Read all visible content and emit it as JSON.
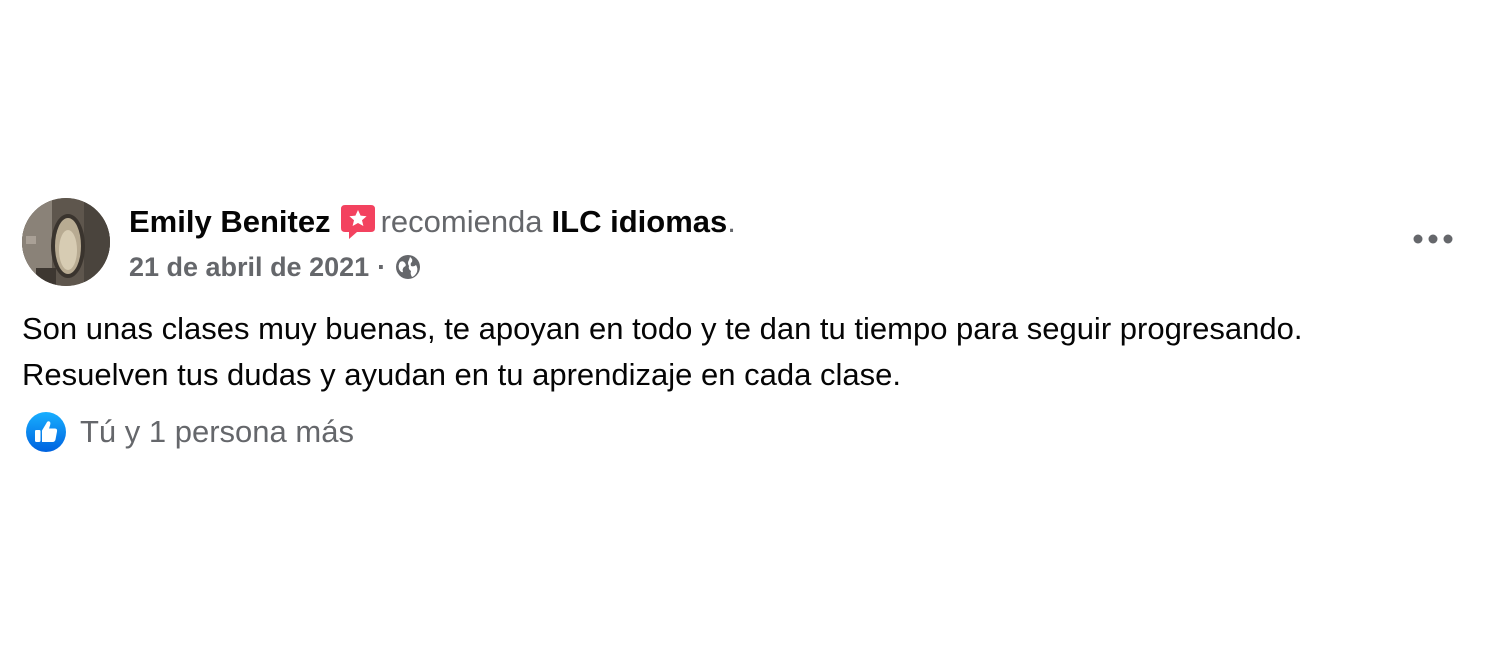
{
  "post": {
    "author_name": "Emily Benitez",
    "verb": "recomienda",
    "page_name": "ILC idiomas",
    "period": ".",
    "date": "21 de abril de 2021",
    "separator": "·",
    "privacy_icon": "globe-icon",
    "recommend_icon": "recommendation-star-icon",
    "more_icon": "more-options-icon",
    "body_lines": [
      "Son unas clases muy buenas, te apoyan en todo y te dan tu tiempo para seguir progresando.",
      "Resuelven tus dudas y ayudan en tu aprendizaje en cada clase."
    ],
    "reactions": {
      "icon": "like-icon",
      "text": "Tú y 1 persona más"
    }
  },
  "colors": {
    "primary_text": "#050505",
    "secondary_text": "#65676b",
    "like_blue": "#1877f2",
    "recommend_red": "#f3425f",
    "background": "#ffffff"
  }
}
